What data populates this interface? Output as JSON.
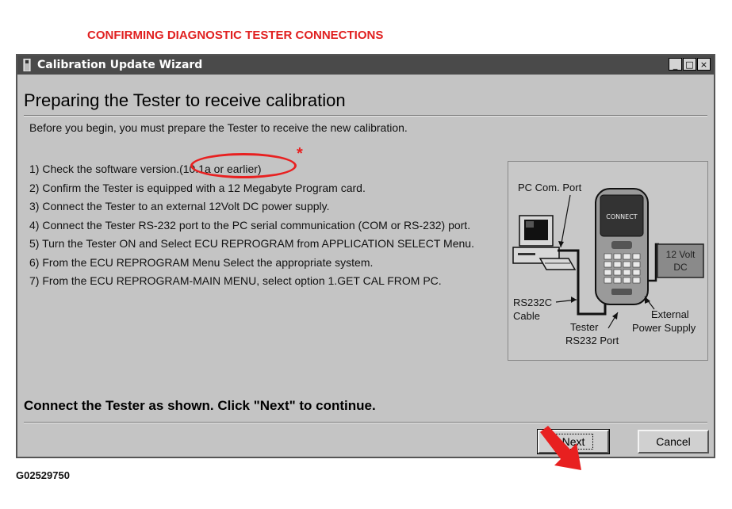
{
  "document": {
    "title": "CONFIRMING DIAGNOSTIC TESTER CONNECTIONS",
    "figure_id": "G02529750"
  },
  "window": {
    "title": "Calibration Update Wizard",
    "controls": {
      "minimize": "_",
      "maximize": "□",
      "close": "×"
    }
  },
  "wizard": {
    "heading": "Preparing the Tester to receive calibration",
    "intro": "Before you begin, you must prepare the Tester to receive the new calibration.",
    "steps": [
      "1) Check the software version.(10.1a or earlier)",
      "2) Confirm the Tester is equipped with a 12 Megabyte Program card.",
      "3) Connect the Tester to an external 12Volt DC power supply.",
      "4) Connect the Tester RS-232 port to the PC serial communication (COM or RS-232) port.",
      "5) Turn the Tester ON and Select ECU REPROGRAM from APPLICATION SELECT Menu.",
      "6) From the ECU REPROGRAM Menu Select the appropriate system.",
      "7) From the ECU REPROGRAM-MAIN MENU, select option 1.GET CAL FROM PC."
    ],
    "annotation_mark": "*",
    "footer_instruction": "Connect the Tester as shown. Click \"Next\" to continue.",
    "buttons": {
      "next": "Next",
      "cancel": "Cancel"
    }
  },
  "diagram": {
    "pc_port_label": "PC Com. Port",
    "cable_label_1": "RS232C",
    "cable_label_2": "Cable",
    "tester_port_label_1": "Tester",
    "tester_port_label_2": "RS232 Port",
    "screen_text": "CONNECT",
    "power_label_1": "12 Volt",
    "power_label_2": "DC",
    "supply_label_1": "External",
    "supply_label_2": "Power Supply"
  },
  "colors": {
    "highlight": "#e82020",
    "window_bg": "#c4c4c4",
    "titlebar": "#4a4a4a"
  }
}
